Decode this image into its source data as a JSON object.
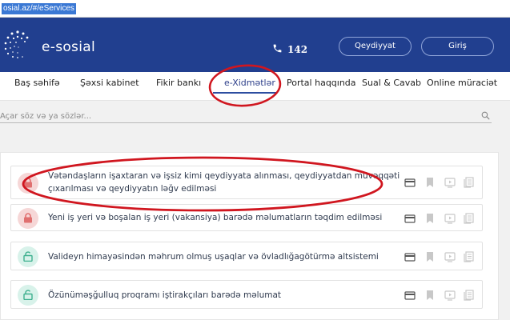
{
  "browser": {
    "url": "osial.az/#/eServices"
  },
  "header": {
    "logo_text": "e-sosial",
    "phone_number": "142",
    "register_label": "Qeydiyyat",
    "login_label": "Giriş"
  },
  "nav": {
    "items": [
      "Baş səhifə",
      "Şəxsi kabinet",
      "Fikir bankı",
      "e-Xidmətlər",
      "Portal haqqında",
      "Sual & Cavab",
      "Online müraciət"
    ],
    "active": "e-Xidmətlər"
  },
  "search": {
    "placeholder": "Açar söz və ya sözlər..."
  },
  "services": [
    {
      "title_line1": "Vətəndaşların işaxtaran və işsiz kimi qeydiyyata alınması, qeydiyyatdan müvəqqəti",
      "title_line2": "çıxarılması və qeydiyyatın ləğv edilməsi",
      "status": "locked"
    },
    {
      "title_line1": "Yeni iş yeri və boşalan iş yeri (vakansiya) barədə məlumatların təqdim edilməsi",
      "title_line2": "",
      "status": "locked"
    },
    {
      "title_line1": "Valideyn himayəsindən məhrum olmuş uşaqlar və övladlığagötürmə altsistemi",
      "title_line2": "",
      "status": "open"
    },
    {
      "title_line1": "Özünüməşğulluq proqramı iştirakçıları barədə məlumat",
      "title_line2": "",
      "status": "open"
    }
  ],
  "colors": {
    "header_bg": "#213f8f",
    "accent": "#2d4ea0",
    "locked": "#e07070",
    "open": "#3fb08f",
    "annotation": "#d0161f"
  },
  "icons": {
    "tools": [
      "card-icon",
      "bookmark-icon",
      "video-icon",
      "document-icon"
    ]
  }
}
